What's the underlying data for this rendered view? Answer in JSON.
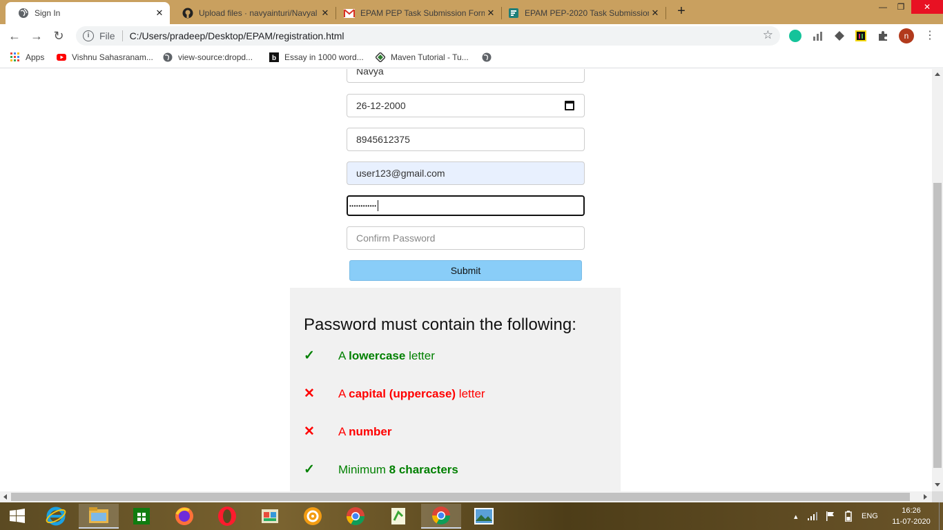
{
  "browser": {
    "tabs": [
      {
        "title": "Sign In",
        "active": true,
        "icon": "globe-icon"
      },
      {
        "title": "Upload files · navyainturi/Navyal",
        "active": false,
        "icon": "github-icon"
      },
      {
        "title": "EPAM PEP Task Submission Form",
        "active": false,
        "icon": "gmail-icon"
      },
      {
        "title": "EPAM PEP-2020 Task Submission",
        "active": false,
        "icon": "forms-icon"
      }
    ],
    "address": {
      "scheme_label": "File",
      "url": "C:/Users/pradeep/Desktop/EPAM/registration.html"
    },
    "profile_initial": "n",
    "bookmarks": [
      {
        "label": "Apps",
        "icon": "apps-grid-icon"
      },
      {
        "label": "Vishnu Sahasranam...",
        "icon": "youtube-icon"
      },
      {
        "label": "view-source:dropd...",
        "icon": "globe-icon"
      },
      {
        "label": "Essay in 1000 word...",
        "icon": "essay-icon"
      },
      {
        "label": "Maven Tutorial - Tu...",
        "icon": "maven-icon"
      },
      {
        "label": "",
        "icon": "globe-icon"
      }
    ]
  },
  "form": {
    "name_value": "Navya",
    "dob_value": "26-12-2000",
    "phone_value": "8945612375",
    "email_value": "user123@gmail.com",
    "password_masked": "••••••••••••",
    "confirm_placeholder": "Confirm Password",
    "submit_label": "Submit"
  },
  "password_rules": {
    "heading": "Password must contain the following:",
    "valid_mark": "✓",
    "invalid_mark": "✕",
    "items": [
      {
        "status": "valid",
        "prefix": "A ",
        "bold": "lowercase",
        "suffix": " letter"
      },
      {
        "status": "invalid",
        "prefix": "A ",
        "bold": "capital (uppercase)",
        "suffix": " letter"
      },
      {
        "status": "invalid",
        "prefix": "A ",
        "bold": "number",
        "suffix": ""
      },
      {
        "status": "valid",
        "prefix": "Minimum ",
        "bold": "8 characters",
        "suffix": ""
      }
    ]
  },
  "colors": {
    "valid": "#008000",
    "invalid": "#ff0000",
    "submit_bg": "#89cdf8",
    "message_bg": "#f1f1f1",
    "tabstrip_bg": "#c9a05f"
  },
  "taskbar": {
    "apps": [
      "windows-start-icon",
      "internet-explorer-icon",
      "file-explorer-icon",
      "store-icon",
      "firefox-icon",
      "opera-icon",
      "control-panel-icon",
      "vlc-icon",
      "chrome-icon",
      "notepad-plus-icon",
      "chrome-active-icon",
      "photos-icon"
    ],
    "language": "ENG",
    "time": "16:26",
    "date": "11-07-2020"
  }
}
